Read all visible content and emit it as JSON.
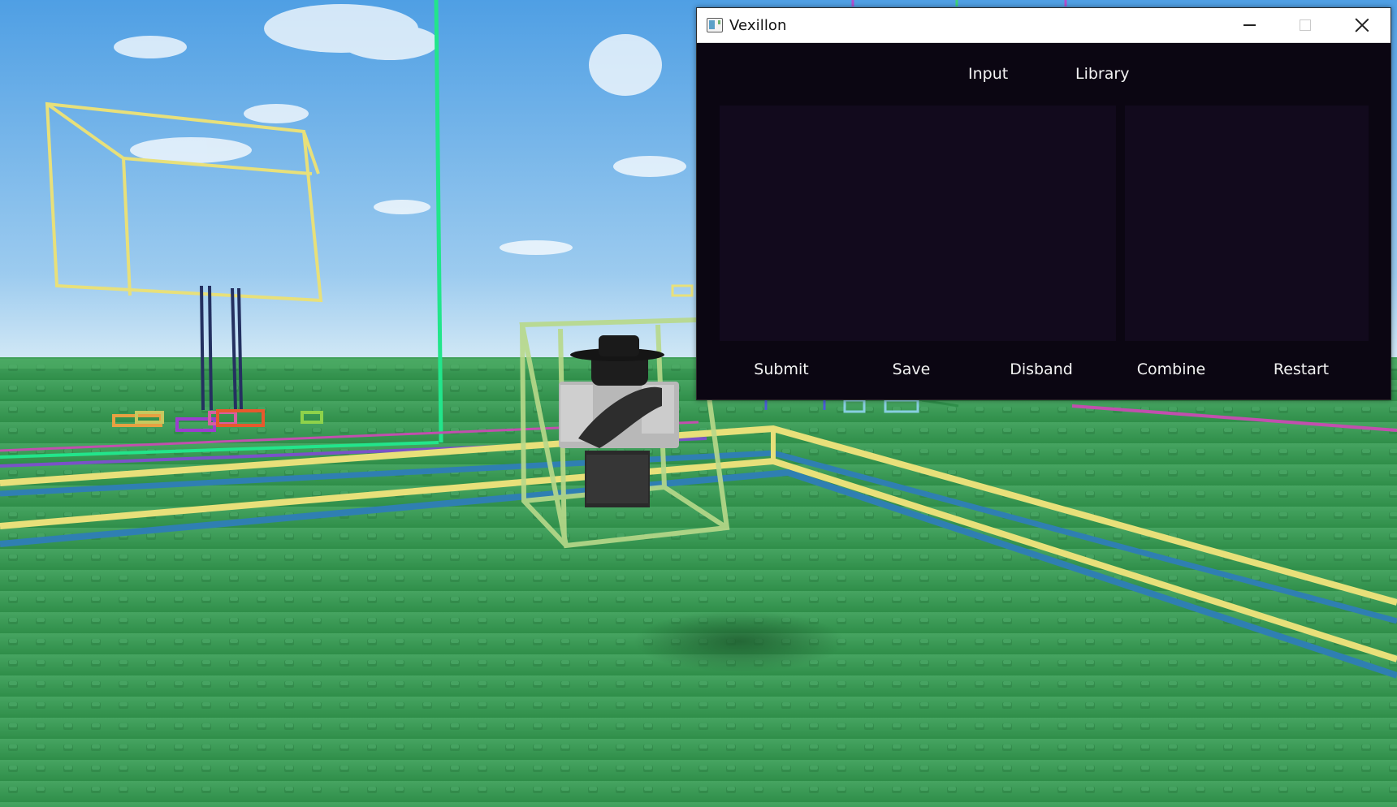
{
  "window": {
    "title": "Vexillon",
    "icon": "app-window-icon",
    "controls": [
      "minimize-icon",
      "maximize-icon",
      "close-icon"
    ]
  },
  "tabs": [
    {
      "label": "Input"
    },
    {
      "label": "Library"
    }
  ],
  "editor": {
    "value": ""
  },
  "library": {
    "items": []
  },
  "actions": {
    "submit": "Submit",
    "save": "Save",
    "disband": "Disband",
    "combine": "Combine",
    "restart": "Restart"
  },
  "colors": {
    "window_background": "#0b0612",
    "pane_background": "#120a1d",
    "text": "#f3f3f3",
    "sky_top": "#5aa6e6",
    "sky_horizon": "#cfe6f5",
    "ground": "#3a9a55"
  }
}
